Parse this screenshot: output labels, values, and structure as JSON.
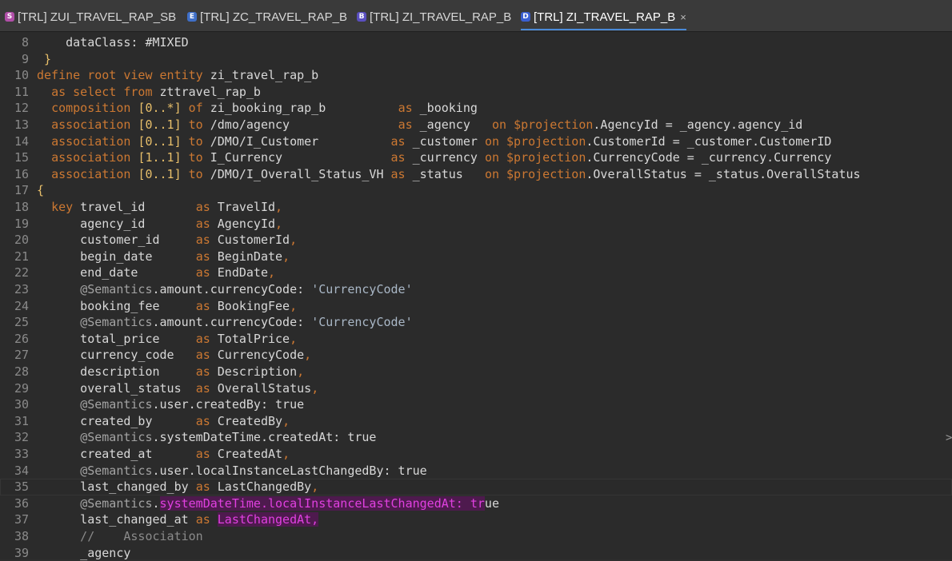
{
  "tabs": [
    {
      "label": "[TRL] ZUI_TRAVEL_RAP_SB",
      "icon": "S",
      "icon_color": "#b14fa8",
      "active": false
    },
    {
      "label": "[TRL] ZC_TRAVEL_RAP_B",
      "icon": "E",
      "icon_color": "#3f6fc8",
      "active": false
    },
    {
      "label": "[TRL] ZI_TRAVEL_RAP_B",
      "icon": "B",
      "icon_color": "#5a4fc0",
      "active": false
    },
    {
      "label": "[TRL] ZI_TRAVEL_RAP_B",
      "icon": "D",
      "icon_color": "#3a5fd0",
      "active": true,
      "close": "×"
    }
  ],
  "lines": [
    {
      "n": "8",
      "text": "    dataClass: #MIXED"
    },
    {
      "n": "9",
      "text": " }"
    },
    {
      "n": "10",
      "text": "define root view entity zi_travel_rap_b"
    },
    {
      "n": "11",
      "text": "  as select from zttravel_rap_b"
    },
    {
      "n": "12",
      "text": "  composition [0..*] of zi_booking_rap_b          as _booking"
    },
    {
      "n": "13",
      "text": "  association [0..1] to /dmo/agency               as _agency   on $projection.AgencyId = _agency.agency_id"
    },
    {
      "n": "14",
      "text": "  association [0..1] to /DMO/I_Customer          as _customer on $projection.CustomerId = _customer.CustomerID"
    },
    {
      "n": "15",
      "text": "  association [1..1] to I_Currency               as _currency on $projection.CurrencyCode = _currency.Currency"
    },
    {
      "n": "16",
      "text": "  association [0..1] to /DMO/I_Overall_Status_VH as _status   on $projection.OverallStatus = _status.OverallStatus"
    },
    {
      "n": "17",
      "text": "{"
    },
    {
      "n": "18",
      "text": "  key travel_id       as TravelId,"
    },
    {
      "n": "19",
      "text": "      agency_id       as AgencyId,"
    },
    {
      "n": "20",
      "text": "      customer_id     as CustomerId,"
    },
    {
      "n": "21",
      "text": "      begin_date      as BeginDate,"
    },
    {
      "n": "22",
      "text": "      end_date        as EndDate,"
    },
    {
      "n": "23",
      "text": "      @Semantics.amount.currencyCode: 'CurrencyCode'"
    },
    {
      "n": "24",
      "text": "      booking_fee     as BookingFee,"
    },
    {
      "n": "25",
      "text": "      @Semantics.amount.currencyCode: 'CurrencyCode'"
    },
    {
      "n": "26",
      "text": "      total_price     as TotalPrice,"
    },
    {
      "n": "27",
      "text": "      currency_code   as CurrencyCode,"
    },
    {
      "n": "28",
      "text": "      description     as Description,"
    },
    {
      "n": "29",
      "text": "      overall_status  as OverallStatus,"
    },
    {
      "n": "30",
      "text": "      @Semantics.user.createdBy: true"
    },
    {
      "n": "31",
      "text": "      created_by      as CreatedBy,"
    },
    {
      "n": "32",
      "text": "      @Semantics.systemDateTime.createdAt: true"
    },
    {
      "n": "33",
      "text": "      created_at      as CreatedAt,"
    },
    {
      "n": "34",
      "text": "      @Semantics.user.localInstanceLastChangedBy: true"
    },
    {
      "n": "35",
      "text": "      last_changed_by as LastChangedBy,"
    },
    {
      "n": "36",
      "text": "      @Semantics.systemDateTime.localInstanceLastChangedAt: true"
    },
    {
      "n": "37",
      "text": "      last_changed_at as LastChangedAt,"
    },
    {
      "n": "38",
      "text": "      //    Association"
    },
    {
      "n": "39",
      "text": "      _agency"
    }
  ],
  "current_line": "35",
  "right_caret": ">"
}
